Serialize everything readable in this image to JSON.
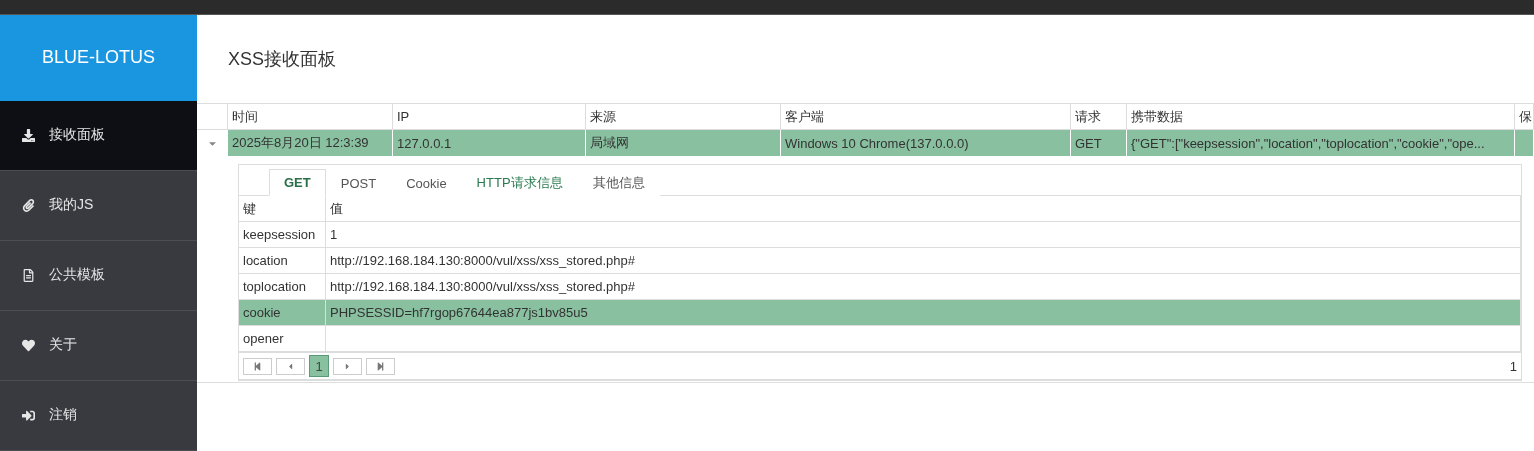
{
  "brand": "BLUE-LOTUS",
  "page_title": "XSS接收面板",
  "sidebar": {
    "items": [
      {
        "label": "接收面板",
        "kind": "download",
        "selected": true
      },
      {
        "label": "我的JS",
        "kind": "attach",
        "selected": false
      },
      {
        "label": "公共模板",
        "kind": "template",
        "selected": false
      },
      {
        "label": "关于",
        "kind": "about",
        "selected": false
      },
      {
        "label": "注销",
        "kind": "logout",
        "selected": false
      }
    ]
  },
  "table": {
    "columns": [
      "时间",
      "IP",
      "来源",
      "客户端",
      "请求",
      "携带数据",
      "保"
    ],
    "rows": [
      {
        "expanded": true,
        "selected": true,
        "cells": [
          "2025年8月20日 12:3:39",
          "127.0.0.1",
          "局域网",
          "Windows 10 Chrome(137.0.0.0)",
          "GET",
          "{\"GET\":[\"keepsession\",\"location\",\"toplocation\",\"cookie\",\"ope...",
          ""
        ]
      }
    ]
  },
  "detail": {
    "tabs": [
      {
        "label": "GET",
        "selected": true,
        "highlighted": false
      },
      {
        "label": "POST",
        "selected": false,
        "highlighted": false
      },
      {
        "label": "Cookie",
        "selected": false,
        "highlighted": false
      },
      {
        "label": "HTTP请求信息",
        "selected": false,
        "highlighted": true
      },
      {
        "label": "其他信息",
        "selected": false,
        "highlighted": false
      }
    ],
    "columns": [
      "键",
      "值"
    ],
    "rows": [
      {
        "key": "keepsession",
        "value": "1",
        "selected": false
      },
      {
        "key": "location",
        "value": "http://192.168.184.130:8000/vul/xss/xss_stored.php#",
        "selected": false
      },
      {
        "key": "toplocation",
        "value": "http://192.168.184.130:8000/vul/xss/xss_stored.php#",
        "selected": false
      },
      {
        "key": "cookie",
        "value": "PHPSESSID=hf7rgop67644ea877js1bv85u5",
        "selected": true
      },
      {
        "key": "opener",
        "value": "",
        "selected": false
      }
    ],
    "pager": {
      "page": "1",
      "info": "1"
    }
  }
}
